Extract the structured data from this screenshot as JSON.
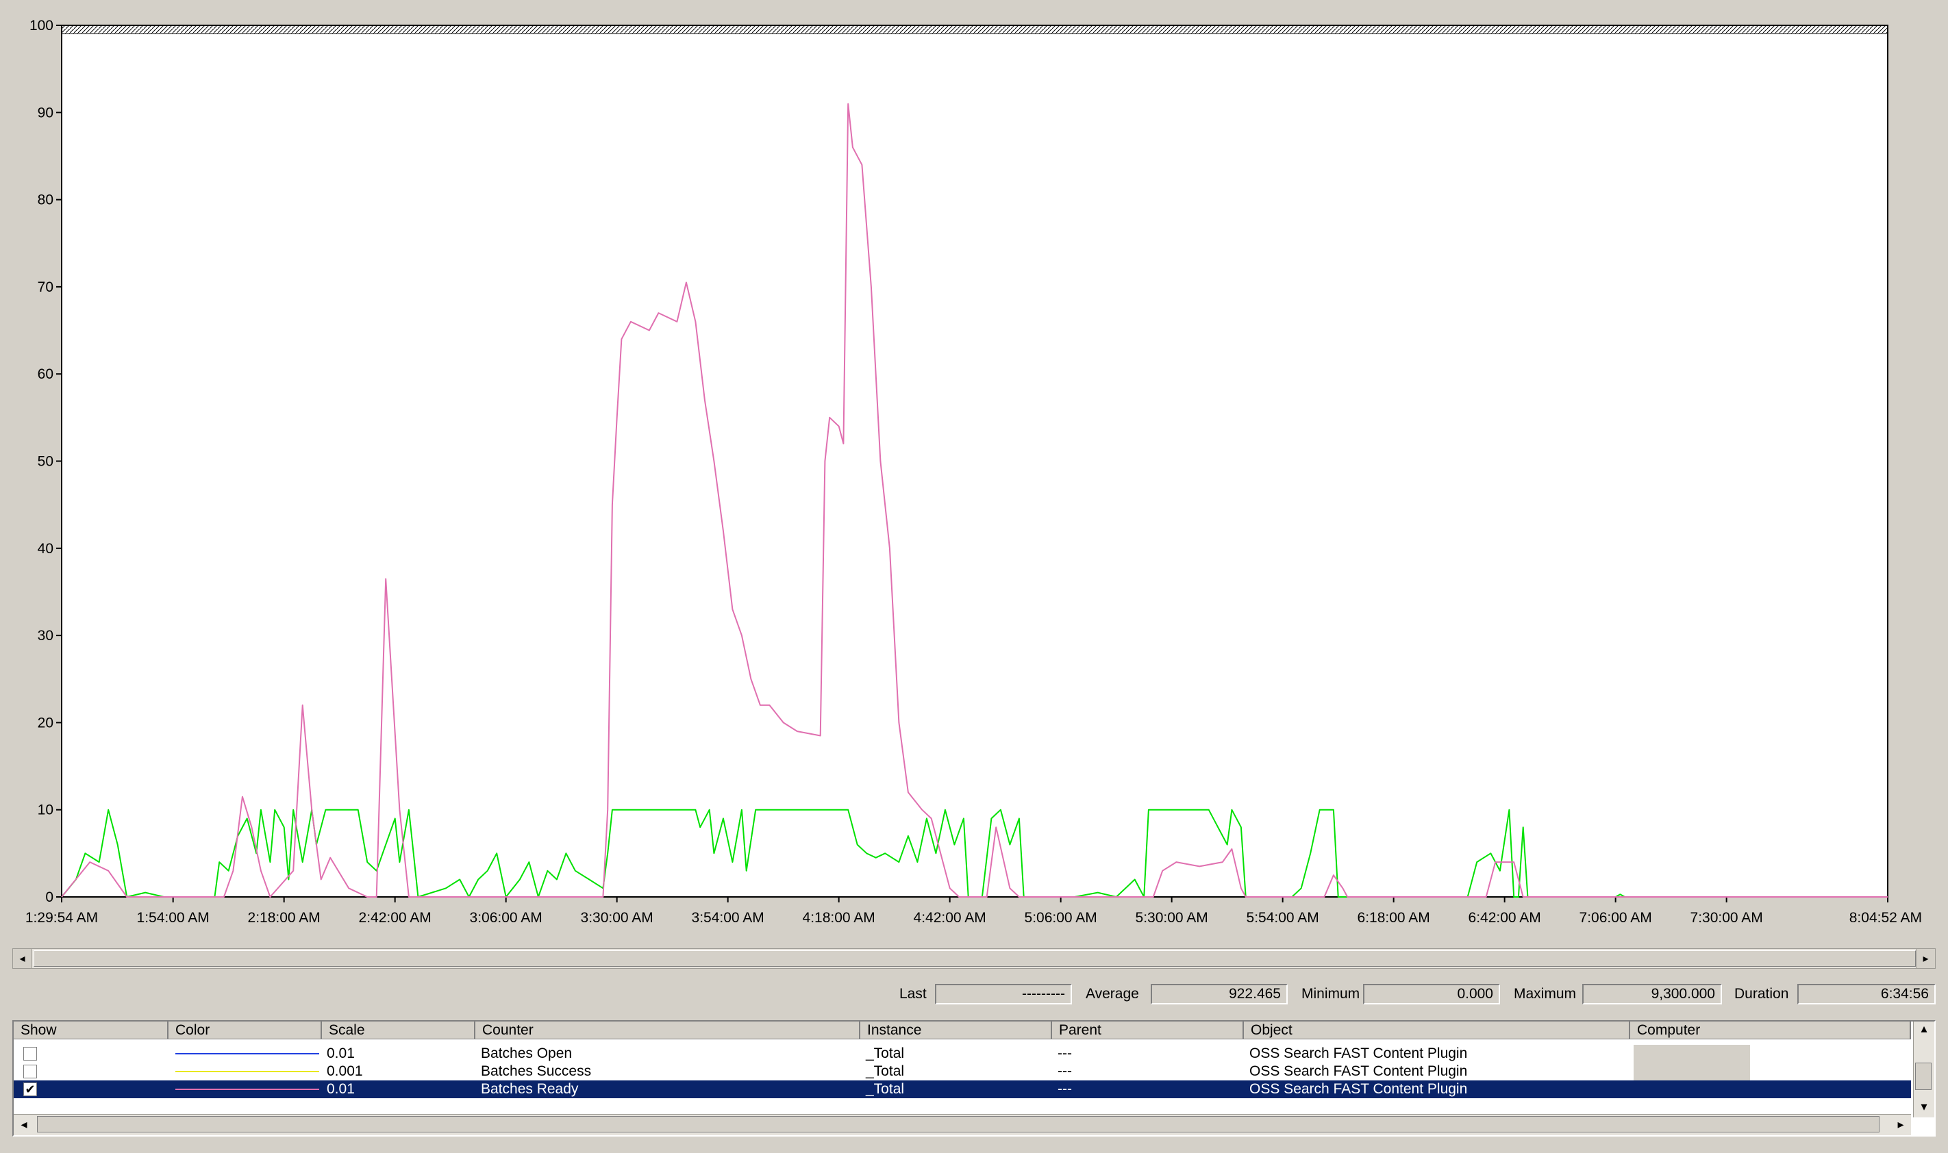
{
  "chart_data": {
    "type": "line",
    "y_ticks": [
      "100",
      "90",
      "80",
      "70",
      "60",
      "50",
      "40",
      "30",
      "20",
      "10",
      "0"
    ],
    "x_ticks": [
      "1:29:54 AM",
      "1:54:00 AM",
      "2:18:00 AM",
      "2:42:00 AM",
      "3:06:00 AM",
      "3:30:00 AM",
      "3:54:00 AM",
      "4:18:00 AM",
      "4:42:00 AM",
      "5:06:00 AM",
      "5:30:00 AM",
      "5:54:00 AM",
      "6:18:00 AM",
      "6:42:00 AM",
      "7:06:00 AM",
      "7:30:00 AM",
      "8:04:52 AM"
    ],
    "ylim": [
      0,
      100
    ],
    "grid": false,
    "series": [
      {
        "name": "Batches Ready",
        "color": "#e070b0",
        "points": [
          [
            "1:29:54 AM",
            0
          ],
          [
            "1:36:00 AM",
            4
          ],
          [
            "1:40:00 AM",
            3
          ],
          [
            "1:44:00 AM",
            0
          ],
          [
            "2:05:00 AM",
            0
          ],
          [
            "2:07:00 AM",
            3
          ],
          [
            "2:09:00 AM",
            11.5
          ],
          [
            "2:11:00 AM",
            8
          ],
          [
            "2:13:00 AM",
            3
          ],
          [
            "2:15:00 AM",
            0
          ],
          [
            "2:20:00 AM",
            3
          ],
          [
            "2:22:00 AM",
            22
          ],
          [
            "2:24:00 AM",
            10
          ],
          [
            "2:26:00 AM",
            2
          ],
          [
            "2:28:00 AM",
            4.5
          ],
          [
            "2:32:00 AM",
            1
          ],
          [
            "2:36:00 AM",
            0
          ],
          [
            "2:38:00 AM",
            0
          ],
          [
            "2:40:00 AM",
            36.5
          ],
          [
            "2:43:00 AM",
            10
          ],
          [
            "2:45:00 AM",
            0
          ],
          [
            "3:27:00 AM",
            0
          ],
          [
            "3:28:00 AM",
            10
          ],
          [
            "3:29:00 AM",
            45
          ],
          [
            "3:30:00 AM",
            55
          ],
          [
            "3:31:00 AM",
            64
          ],
          [
            "3:33:00 AM",
            66
          ],
          [
            "3:37:00 AM",
            65
          ],
          [
            "3:39:00 AM",
            67
          ],
          [
            "3:43:00 AM",
            66
          ],
          [
            "3:45:00 AM",
            70.5
          ],
          [
            "3:47:00 AM",
            66
          ],
          [
            "3:49:00 AM",
            57
          ],
          [
            "3:51:00 AM",
            50
          ],
          [
            "3:53:00 AM",
            42
          ],
          [
            "3:55:00 AM",
            33
          ],
          [
            "3:57:00 AM",
            30
          ],
          [
            "3:59:00 AM",
            25
          ],
          [
            "4:01:00 AM",
            22
          ],
          [
            "4:03:00 AM",
            22
          ],
          [
            "4:06:00 AM",
            20
          ],
          [
            "4:09:00 AM",
            19
          ],
          [
            "4:14:00 AM",
            18.5
          ],
          [
            "4:15:00 AM",
            50
          ],
          [
            "4:16:00 AM",
            55
          ],
          [
            "4:18:00 AM",
            54
          ],
          [
            "4:19:00 AM",
            52
          ],
          [
            "4:20:00 AM",
            91
          ],
          [
            "4:21:00 AM",
            86
          ],
          [
            "4:23:00 AM",
            84
          ],
          [
            "4:25:00 AM",
            70
          ],
          [
            "4:27:00 AM",
            50
          ],
          [
            "4:29:00 AM",
            40
          ],
          [
            "4:31:00 AM",
            20
          ],
          [
            "4:33:00 AM",
            12
          ],
          [
            "4:36:00 AM",
            10
          ],
          [
            "4:38:00 AM",
            9
          ],
          [
            "4:40:00 AM",
            5
          ],
          [
            "4:42:00 AM",
            1
          ],
          [
            "4:44:00 AM",
            0
          ],
          [
            "4:50:00 AM",
            0
          ],
          [
            "4:52:00 AM",
            8
          ],
          [
            "4:55:00 AM",
            1
          ],
          [
            "4:57:00 AM",
            0
          ],
          [
            "5:26:00 AM",
            0
          ],
          [
            "5:28:00 AM",
            3
          ],
          [
            "5:31:00 AM",
            4
          ],
          [
            "5:36:00 AM",
            3.5
          ],
          [
            "5:41:00 AM",
            4
          ],
          [
            "5:43:00 AM",
            5.5
          ],
          [
            "5:45:00 AM",
            1
          ],
          [
            "5:46:00 AM",
            0
          ],
          [
            "6:03:00 AM",
            0
          ],
          [
            "6:05:00 AM",
            2.5
          ],
          [
            "6:07:00 AM",
            1
          ],
          [
            "6:08:00 AM",
            0
          ],
          [
            "6:38:00 AM",
            0
          ],
          [
            "6:40:00 AM",
            4
          ],
          [
            "6:44:00 AM",
            4
          ],
          [
            "6:46:00 AM",
            0
          ],
          [
            "8:04:52 AM",
            0
          ]
        ]
      },
      {
        "name": "",
        "color": "#00e000",
        "points": [
          [
            "1:29:54 AM",
            0
          ],
          [
            "1:33:00 AM",
            2
          ],
          [
            "1:35:00 AM",
            5
          ],
          [
            "1:38:00 AM",
            4
          ],
          [
            "1:40:00 AM",
            10
          ],
          [
            "1:42:00 AM",
            6
          ],
          [
            "1:44:00 AM",
            0
          ],
          [
            "1:48:00 AM",
            0.5
          ],
          [
            "1:52:00 AM",
            0
          ],
          [
            "2:03:00 AM",
            0
          ],
          [
            "2:04:00 AM",
            4
          ],
          [
            "2:06:00 AM",
            3
          ],
          [
            "2:08:00 AM",
            7
          ],
          [
            "2:10:00 AM",
            9
          ],
          [
            "2:12:00 AM",
            5
          ],
          [
            "2:13:00 AM",
            10
          ],
          [
            "2:15:00 AM",
            4
          ],
          [
            "2:16:00 AM",
            10
          ],
          [
            "2:18:00 AM",
            8
          ],
          [
            "2:19:00 AM",
            2
          ],
          [
            "2:20:00 AM",
            10
          ],
          [
            "2:22:00 AM",
            4
          ],
          [
            "2:24:00 AM",
            10
          ],
          [
            "2:25:00 AM",
            6
          ],
          [
            "2:27:00 AM",
            10
          ],
          [
            "2:34:00 AM",
            10
          ],
          [
            "2:36:00 AM",
            4
          ],
          [
            "2:38:00 AM",
            3
          ],
          [
            "2:40:00 AM",
            6
          ],
          [
            "2:42:00 AM",
            9
          ],
          [
            "2:43:00 AM",
            4
          ],
          [
            "2:45:00 AM",
            10
          ],
          [
            "2:46:00 AM",
            5
          ],
          [
            "2:47:00 AM",
            0
          ],
          [
            "2:53:00 AM",
            1
          ],
          [
            "2:56:00 AM",
            2
          ],
          [
            "2:58:00 AM",
            0
          ],
          [
            "3:00:00 AM",
            2
          ],
          [
            "3:02:00 AM",
            3
          ],
          [
            "3:04:00 AM",
            5
          ],
          [
            "3:06:00 AM",
            0
          ],
          [
            "3:09:00 AM",
            2
          ],
          [
            "3:11:00 AM",
            4
          ],
          [
            "3:13:00 AM",
            0
          ],
          [
            "3:15:00 AM",
            3
          ],
          [
            "3:17:00 AM",
            2
          ],
          [
            "3:19:00 AM",
            5
          ],
          [
            "3:21:00 AM",
            3
          ],
          [
            "3:24:00 AM",
            2
          ],
          [
            "3:27:00 AM",
            1
          ],
          [
            "3:28:00 AM",
            5
          ],
          [
            "3:29:00 AM",
            10
          ],
          [
            "3:47:00 AM",
            10
          ],
          [
            "3:48:00 AM",
            8
          ],
          [
            "3:50:00 AM",
            10
          ],
          [
            "3:51:00 AM",
            5
          ],
          [
            "3:53:00 AM",
            9
          ],
          [
            "3:55:00 AM",
            4
          ],
          [
            "3:57:00 AM",
            10
          ],
          [
            "3:58:00 AM",
            3
          ],
          [
            "4:00:00 AM",
            10
          ],
          [
            "4:20:00 AM",
            10
          ],
          [
            "4:22:00 AM",
            6
          ],
          [
            "4:24:00 AM",
            5
          ],
          [
            "4:26:00 AM",
            4.5
          ],
          [
            "4:28:00 AM",
            5
          ],
          [
            "4:31:00 AM",
            4
          ],
          [
            "4:33:00 AM",
            7
          ],
          [
            "4:35:00 AM",
            4
          ],
          [
            "4:37:00 AM",
            9
          ],
          [
            "4:39:00 AM",
            5
          ],
          [
            "4:41:00 AM",
            10
          ],
          [
            "4:43:00 AM",
            6
          ],
          [
            "4:45:00 AM",
            9
          ],
          [
            "4:46:00 AM",
            0
          ],
          [
            "4:49:00 AM",
            0
          ],
          [
            "4:51:00 AM",
            9
          ],
          [
            "4:53:00 AM",
            10
          ],
          [
            "4:55:00 AM",
            6
          ],
          [
            "4:57:00 AM",
            9
          ],
          [
            "4:58:00 AM",
            0
          ],
          [
            "5:09:00 AM",
            0
          ],
          [
            "5:14:00 AM",
            0.5
          ],
          [
            "5:18:00 AM",
            0
          ],
          [
            "5:22:00 AM",
            2
          ],
          [
            "5:24:00 AM",
            0
          ],
          [
            "5:25:00 AM",
            10
          ],
          [
            "5:38:00 AM",
            10
          ],
          [
            "5:40:00 AM",
            8
          ],
          [
            "5:42:00 AM",
            6
          ],
          [
            "5:43:00 AM",
            10
          ],
          [
            "5:45:00 AM",
            8
          ],
          [
            "5:46:00 AM",
            0
          ],
          [
            "5:56:00 AM",
            0
          ],
          [
            "5:58:00 AM",
            1
          ],
          [
            "6:00:00 AM",
            5
          ],
          [
            "6:02:00 AM",
            10
          ],
          [
            "6:05:00 AM",
            10
          ],
          [
            "6:06:00 AM",
            0
          ],
          [
            "6:34:00 AM",
            0
          ],
          [
            "6:36:00 AM",
            4
          ],
          [
            "6:39:00 AM",
            5
          ],
          [
            "6:41:00 AM",
            3
          ],
          [
            "6:43:00 AM",
            10
          ],
          [
            "6:44:00 AM",
            0
          ],
          [
            "6:45:00 AM",
            0
          ],
          [
            "6:46:00 AM",
            8
          ],
          [
            "6:47:00 AM",
            0
          ],
          [
            "7:06:00 AM",
            0
          ],
          [
            "7:07:00 AM",
            0.3
          ],
          [
            "7:08:00 AM",
            0
          ],
          [
            "8:04:52 AM",
            0
          ]
        ]
      }
    ]
  },
  "stats": {
    "last_label": "Last",
    "last_value": "---------",
    "average_label": "Average",
    "average_value": "922.465",
    "minimum_label": "Minimum",
    "minimum_value": "0.000",
    "maximum_label": "Maximum",
    "maximum_value": "9,300.000",
    "duration_label": "Duration",
    "duration_value": "6:34:56"
  },
  "table": {
    "headers": [
      "Show",
      "Color",
      "Scale",
      "Counter",
      "Instance",
      "Parent",
      "Object",
      "Computer"
    ],
    "rows": [
      {
        "show": false,
        "color": "#2040e0",
        "scale": "0.01",
        "counter": "Batches Open",
        "instance": "_Total",
        "parent": "---",
        "object": "OSS Search FAST Content Plugin"
      },
      {
        "show": false,
        "color": "#e8e820",
        "scale": "0.001",
        "counter": "Batches Success",
        "instance": "_Total",
        "parent": "---",
        "object": "OSS Search FAST Content Plugin"
      },
      {
        "show": true,
        "color": "#e070b0",
        "scale": "0.01",
        "counter": "Batches Ready",
        "instance": "_Total",
        "parent": "---",
        "object": "OSS Search FAST Content Plugin",
        "selected": true
      }
    ],
    "check_glyph": "✔"
  },
  "icons": {
    "scroll_left": "◂",
    "scroll_right": "▸",
    "scroll_up": "▴",
    "scroll_down": "▾"
  }
}
